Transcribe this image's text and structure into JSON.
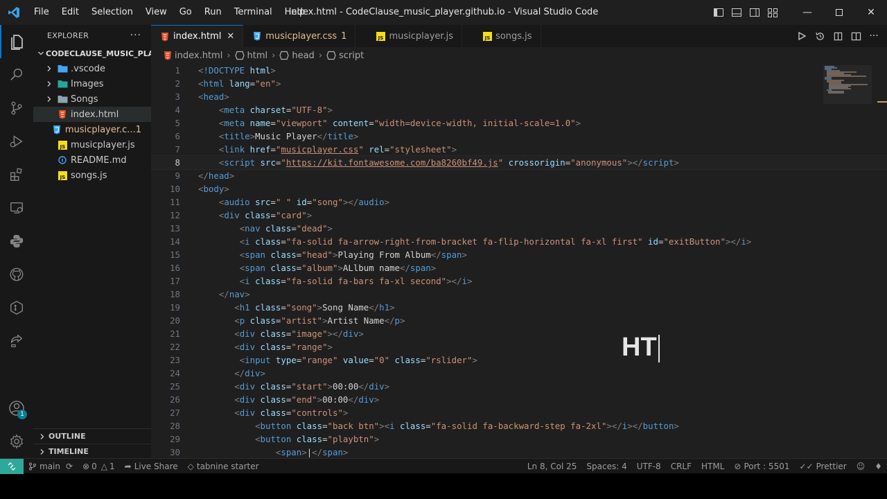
{
  "window": {
    "title": "index.html - CodeClause_music_player.github.io - Visual Studio Code",
    "menu": [
      "File",
      "Edit",
      "Selection",
      "View",
      "Go",
      "Run",
      "Terminal",
      "Help"
    ]
  },
  "sidebar": {
    "title": "EXPLORER",
    "folder": "CODECLAUSE_MUSIC_PLA...",
    "items": [
      {
        "label": ".vscode",
        "type": "folder",
        "color": "#cccccc"
      },
      {
        "label": "Images",
        "type": "folder",
        "color": "#cccccc"
      },
      {
        "label": "Songs",
        "type": "folder",
        "color": "#cccccc"
      },
      {
        "label": "index.html",
        "type": "html",
        "color": "#cccccc"
      },
      {
        "label": "musicplayer.c...",
        "type": "css",
        "color": "#e2c08d",
        "badge": "1"
      },
      {
        "label": "musicplayer.js",
        "type": "js",
        "color": "#cccccc"
      },
      {
        "label": "README.md",
        "type": "md",
        "color": "#cccccc"
      },
      {
        "label": "songs.js",
        "type": "js",
        "color": "#cccccc"
      }
    ],
    "outline": "OUTLINE",
    "timeline": "TIMELINE",
    "accounts_badge": "1"
  },
  "tabs": [
    {
      "label": "index.html",
      "type": "html",
      "active": true
    },
    {
      "label": "musicplayer.css",
      "type": "css",
      "modified": "1"
    },
    {
      "label": "musicplayer.js",
      "type": "js"
    },
    {
      "label": "songs.js",
      "type": "js"
    }
  ],
  "breadcrumb": [
    "index.html",
    "html",
    "head",
    "script"
  ],
  "code": {
    "current_line": 8,
    "lines": [
      [
        [
          "t-b",
          "<"
        ],
        [
          "t-dt",
          "!DOCTYPE"
        ],
        [
          "t-attr",
          " html"
        ],
        [
          "t-b",
          ">"
        ]
      ],
      [
        [
          "t-b",
          "<"
        ],
        [
          "t-tag",
          "html"
        ],
        [
          "t-attr",
          " lang"
        ],
        [
          "t-txt",
          "="
        ],
        [
          "t-str",
          "\"en\""
        ],
        [
          "t-b",
          ">"
        ]
      ],
      [
        [
          "t-b",
          "<"
        ],
        [
          "t-tag",
          "head"
        ],
        [
          "t-b",
          ">"
        ]
      ],
      [
        [
          "t-txt",
          "    "
        ],
        [
          "t-b",
          "<"
        ],
        [
          "t-tag",
          "meta"
        ],
        [
          "t-attr",
          " charset"
        ],
        [
          "t-txt",
          "="
        ],
        [
          "t-str",
          "\"UTF-8\""
        ],
        [
          "t-b",
          ">"
        ]
      ],
      [
        [
          "t-txt",
          "    "
        ],
        [
          "t-b",
          "<"
        ],
        [
          "t-tag",
          "meta"
        ],
        [
          "t-attr",
          " name"
        ],
        [
          "t-txt",
          "="
        ],
        [
          "t-str",
          "\"viewport\""
        ],
        [
          "t-attr",
          " content"
        ],
        [
          "t-txt",
          "="
        ],
        [
          "t-str",
          "\"width=device-width, initial-scale=1.0\""
        ],
        [
          "t-b",
          ">"
        ]
      ],
      [
        [
          "t-txt",
          "    "
        ],
        [
          "t-b",
          "<"
        ],
        [
          "t-tag",
          "title"
        ],
        [
          "t-b",
          ">"
        ],
        [
          "t-txt",
          "Music Player"
        ],
        [
          "t-b",
          "</"
        ],
        [
          "t-tag",
          "title"
        ],
        [
          "t-b",
          ">"
        ]
      ],
      [
        [
          "t-txt",
          "    "
        ],
        [
          "t-b",
          "<"
        ],
        [
          "t-tag",
          "link"
        ],
        [
          "t-attr",
          " href"
        ],
        [
          "t-txt",
          "="
        ],
        [
          "t-str",
          "\""
        ],
        [
          "t-str t-link",
          "musicplayer.css"
        ],
        [
          "t-str",
          "\""
        ],
        [
          "t-attr",
          " rel"
        ],
        [
          "t-txt",
          "="
        ],
        [
          "t-str",
          "\"stylesheet\""
        ],
        [
          "t-b",
          ">"
        ]
      ],
      [
        [
          "t-txt",
          "    "
        ],
        [
          "t-b",
          "<"
        ],
        [
          "t-tag",
          "script"
        ],
        [
          "t-attr",
          " src"
        ],
        [
          "t-txt",
          "="
        ],
        [
          "t-str",
          "\""
        ],
        [
          "t-str t-link",
          "https://kit.fontawesome.com/ba8260bf49.js"
        ],
        [
          "t-str",
          "\""
        ],
        [
          "t-attr",
          " crossorigin"
        ],
        [
          "t-txt",
          "="
        ],
        [
          "t-str",
          "\"anonymous\""
        ],
        [
          "t-b",
          "></"
        ],
        [
          "t-tag",
          "script"
        ],
        [
          "t-b",
          ">"
        ]
      ],
      [
        [
          "t-b",
          "</"
        ],
        [
          "t-tag",
          "head"
        ],
        [
          "t-b",
          ">"
        ]
      ],
      [
        [
          "t-b",
          "<"
        ],
        [
          "t-tag",
          "body"
        ],
        [
          "t-b",
          ">"
        ]
      ],
      [
        [
          "t-txt",
          "    "
        ],
        [
          "t-b",
          "<"
        ],
        [
          "t-tag",
          "audio"
        ],
        [
          "t-attr",
          " src"
        ],
        [
          "t-txt",
          "="
        ],
        [
          "t-str",
          "\" \""
        ],
        [
          "t-attr",
          " id"
        ],
        [
          "t-txt",
          "="
        ],
        [
          "t-str",
          "\"song\""
        ],
        [
          "t-b",
          "></"
        ],
        [
          "t-tag",
          "audio"
        ],
        [
          "t-b",
          ">"
        ]
      ],
      [
        [
          "t-txt",
          "    "
        ],
        [
          "t-b",
          "<"
        ],
        [
          "t-tag",
          "div"
        ],
        [
          "t-attr",
          " class"
        ],
        [
          "t-txt",
          "="
        ],
        [
          "t-str",
          "\"card\""
        ],
        [
          "t-b",
          ">"
        ]
      ],
      [
        [
          "t-txt",
          "        "
        ],
        [
          "t-b",
          "<"
        ],
        [
          "t-tag",
          "nav"
        ],
        [
          "t-attr",
          " class"
        ],
        [
          "t-txt",
          "="
        ],
        [
          "t-str",
          "\"dead\""
        ],
        [
          "t-b",
          ">"
        ]
      ],
      [
        [
          "t-txt",
          "        "
        ],
        [
          "t-b",
          "<"
        ],
        [
          "t-tag",
          "i"
        ],
        [
          "t-attr",
          " class"
        ],
        [
          "t-txt",
          "="
        ],
        [
          "t-str",
          "\"fa-solid fa-arrow-right-from-bracket fa-flip-horizontal fa-xl first\""
        ],
        [
          "t-attr",
          " id"
        ],
        [
          "t-txt",
          "="
        ],
        [
          "t-str",
          "\"exitButton\""
        ],
        [
          "t-b",
          "></"
        ],
        [
          "t-tag",
          "i"
        ],
        [
          "t-b",
          ">"
        ]
      ],
      [
        [
          "t-txt",
          "        "
        ],
        [
          "t-b",
          "<"
        ],
        [
          "t-tag",
          "span"
        ],
        [
          "t-attr",
          " class"
        ],
        [
          "t-txt",
          "="
        ],
        [
          "t-str",
          "\"head\""
        ],
        [
          "t-b",
          ">"
        ],
        [
          "t-txt",
          "Playing From Album"
        ],
        [
          "t-b",
          "</"
        ],
        [
          "t-tag",
          "span"
        ],
        [
          "t-b",
          ">"
        ]
      ],
      [
        [
          "t-txt",
          "        "
        ],
        [
          "t-b",
          "<"
        ],
        [
          "t-tag",
          "span"
        ],
        [
          "t-attr",
          " class"
        ],
        [
          "t-txt",
          "="
        ],
        [
          "t-str",
          "\"album\""
        ],
        [
          "t-b",
          ">"
        ],
        [
          "t-txt",
          "ALlbum name"
        ],
        [
          "t-b",
          "</"
        ],
        [
          "t-tag",
          "span"
        ],
        [
          "t-b",
          ">"
        ]
      ],
      [
        [
          "t-txt",
          "        "
        ],
        [
          "t-b",
          "<"
        ],
        [
          "t-tag",
          "i"
        ],
        [
          "t-attr",
          " class"
        ],
        [
          "t-txt",
          "="
        ],
        [
          "t-str",
          "\"fa-solid fa-bars fa-xl second\""
        ],
        [
          "t-b",
          "></"
        ],
        [
          "t-tag",
          "i"
        ],
        [
          "t-b",
          ">"
        ]
      ],
      [
        [
          "t-txt",
          "    "
        ],
        [
          "t-b",
          "</"
        ],
        [
          "t-tag",
          "nav"
        ],
        [
          "t-b",
          ">"
        ]
      ],
      [
        [
          "t-txt",
          "       "
        ],
        [
          "t-b",
          "<"
        ],
        [
          "t-tag",
          "h1"
        ],
        [
          "t-attr",
          " class"
        ],
        [
          "t-txt",
          "="
        ],
        [
          "t-str",
          "\"song\""
        ],
        [
          "t-b",
          ">"
        ],
        [
          "t-txt",
          "Song Name"
        ],
        [
          "t-b",
          "</"
        ],
        [
          "t-tag",
          "h1"
        ],
        [
          "t-b",
          ">"
        ]
      ],
      [
        [
          "t-txt",
          "       "
        ],
        [
          "t-b",
          "<"
        ],
        [
          "t-tag",
          "p"
        ],
        [
          "t-attr",
          " class"
        ],
        [
          "t-txt",
          "="
        ],
        [
          "t-str",
          "\"artist\""
        ],
        [
          "t-b",
          ">"
        ],
        [
          "t-txt",
          "Artist Name"
        ],
        [
          "t-b",
          "</"
        ],
        [
          "t-tag",
          "p"
        ],
        [
          "t-b",
          ">"
        ]
      ],
      [
        [
          "t-txt",
          "       "
        ],
        [
          "t-b",
          "<"
        ],
        [
          "t-tag",
          "div"
        ],
        [
          "t-attr",
          " class"
        ],
        [
          "t-txt",
          "="
        ],
        [
          "t-str",
          "\"image\""
        ],
        [
          "t-b",
          "></"
        ],
        [
          "t-tag",
          "div"
        ],
        [
          "t-b",
          ">"
        ]
      ],
      [
        [
          "t-txt",
          "       "
        ],
        [
          "t-b",
          "<"
        ],
        [
          "t-tag",
          "div"
        ],
        [
          "t-attr",
          " class"
        ],
        [
          "t-txt",
          "="
        ],
        [
          "t-str",
          "\"range\""
        ],
        [
          "t-b",
          ">"
        ]
      ],
      [
        [
          "t-txt",
          "        "
        ],
        [
          "t-b",
          "<"
        ],
        [
          "t-tag",
          "input"
        ],
        [
          "t-attr",
          " type"
        ],
        [
          "t-txt",
          "="
        ],
        [
          "t-str",
          "\"range\""
        ],
        [
          "t-attr",
          " value"
        ],
        [
          "t-txt",
          "="
        ],
        [
          "t-str",
          "\"0\""
        ],
        [
          "t-attr",
          " class"
        ],
        [
          "t-txt",
          "="
        ],
        [
          "t-str",
          "\"rslider\""
        ],
        [
          "t-b",
          ">"
        ]
      ],
      [
        [
          "t-txt",
          "       "
        ],
        [
          "t-b",
          "</"
        ],
        [
          "t-tag",
          "div"
        ],
        [
          "t-b",
          ">"
        ]
      ],
      [
        [
          "t-txt",
          "       "
        ],
        [
          "t-b",
          "<"
        ],
        [
          "t-tag",
          "div"
        ],
        [
          "t-attr",
          " class"
        ],
        [
          "t-txt",
          "="
        ],
        [
          "t-str",
          "\"start\""
        ],
        [
          "t-b",
          ">"
        ],
        [
          "t-txt",
          "00:00"
        ],
        [
          "t-b",
          "</"
        ],
        [
          "t-tag",
          "div"
        ],
        [
          "t-b",
          ">"
        ]
      ],
      [
        [
          "t-txt",
          "       "
        ],
        [
          "t-b",
          "<"
        ],
        [
          "t-tag",
          "div"
        ],
        [
          "t-attr",
          " class"
        ],
        [
          "t-txt",
          "="
        ],
        [
          "t-str",
          "\"end\""
        ],
        [
          "t-b",
          ">"
        ],
        [
          "t-txt",
          "00:00"
        ],
        [
          "t-b",
          "</"
        ],
        [
          "t-tag",
          "div"
        ],
        [
          "t-b",
          ">"
        ]
      ],
      [
        [
          "t-txt",
          "       "
        ],
        [
          "t-b",
          "<"
        ],
        [
          "t-tag",
          "div"
        ],
        [
          "t-attr",
          " class"
        ],
        [
          "t-txt",
          "="
        ],
        [
          "t-str",
          "\"controls\""
        ],
        [
          "t-b",
          ">"
        ]
      ],
      [
        [
          "t-txt",
          "           "
        ],
        [
          "t-b",
          "<"
        ],
        [
          "t-tag",
          "button"
        ],
        [
          "t-attr",
          " class"
        ],
        [
          "t-txt",
          "="
        ],
        [
          "t-str",
          "\"back btn\""
        ],
        [
          "t-b",
          "><"
        ],
        [
          "t-tag",
          "i"
        ],
        [
          "t-attr",
          " class"
        ],
        [
          "t-txt",
          "="
        ],
        [
          "t-str",
          "\"fa-solid fa-backward-step fa-2xl\""
        ],
        [
          "t-b",
          "></"
        ],
        [
          "t-tag",
          "i"
        ],
        [
          "t-b",
          "></"
        ],
        [
          "t-tag",
          "button"
        ],
        [
          "t-b",
          ">"
        ]
      ],
      [
        [
          "t-txt",
          "           "
        ],
        [
          "t-b",
          "<"
        ],
        [
          "t-tag",
          "button"
        ],
        [
          "t-attr",
          " class"
        ],
        [
          "t-txt",
          "="
        ],
        [
          "t-str",
          "\"playbtn\""
        ],
        [
          "t-b",
          ">"
        ]
      ],
      [
        [
          "t-txt",
          "               "
        ],
        [
          "t-b",
          "<"
        ],
        [
          "t-tag",
          "span"
        ],
        [
          "t-b",
          ">"
        ],
        [
          "t-txt",
          "|"
        ],
        [
          "t-b",
          "</"
        ],
        [
          "t-tag",
          "span"
        ],
        [
          "t-b",
          ">"
        ]
      ]
    ]
  },
  "overlay_text": "HT",
  "statusbar": {
    "branch": "main",
    "errors": "0",
    "warnings": "1",
    "live_share": "Live Share",
    "tabnine": "tabnine starter",
    "position": "Ln 8, Col 25",
    "spaces": "Spaces: 4",
    "encoding": "UTF-8",
    "eol": "CRLF",
    "language": "HTML",
    "port": "Port : 5501",
    "prettier": "Prettier"
  },
  "colors": {
    "accent": "#0078d4",
    "html_icon": "#e44d26",
    "css_icon": "#42a5f5",
    "js_icon": "#f5de19",
    "modified": "#e2c08d",
    "remote": "#2ea89b"
  }
}
